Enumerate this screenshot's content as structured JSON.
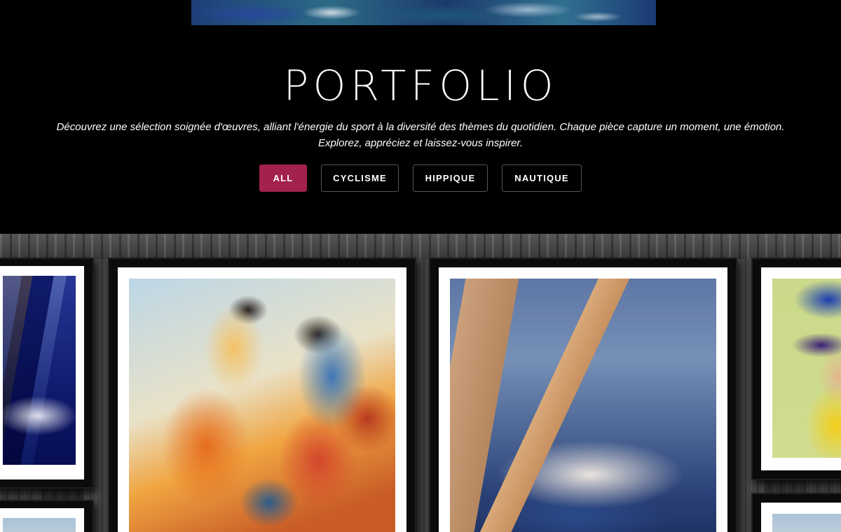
{
  "header": {
    "title": "PORTFOLIO",
    "description_line1": "Découvrez une sélection soignée d'œuvres, alliant l'énergie du sport à la diversité des thèmes du quotidien. Chaque pièce capture un moment, une émotion.",
    "description_line2": "Explorez, appréciez et laissez-vous inspirer."
  },
  "filters": [
    {
      "label": "ALL",
      "active": true
    },
    {
      "label": "CYCLISME",
      "active": false
    },
    {
      "label": "HIPPIQUE",
      "active": false
    },
    {
      "label": "NAUTIQUE",
      "active": false
    }
  ],
  "colors": {
    "accent": "#a3214e",
    "background": "#000000"
  },
  "gallery": {
    "items": [
      {
        "subject": "sailboat-painting"
      },
      {
        "subject": "horse-racing-painting"
      },
      {
        "subject": "sailing-yacht-painting"
      },
      {
        "subject": "cyclist-portrait-painting"
      }
    ]
  }
}
